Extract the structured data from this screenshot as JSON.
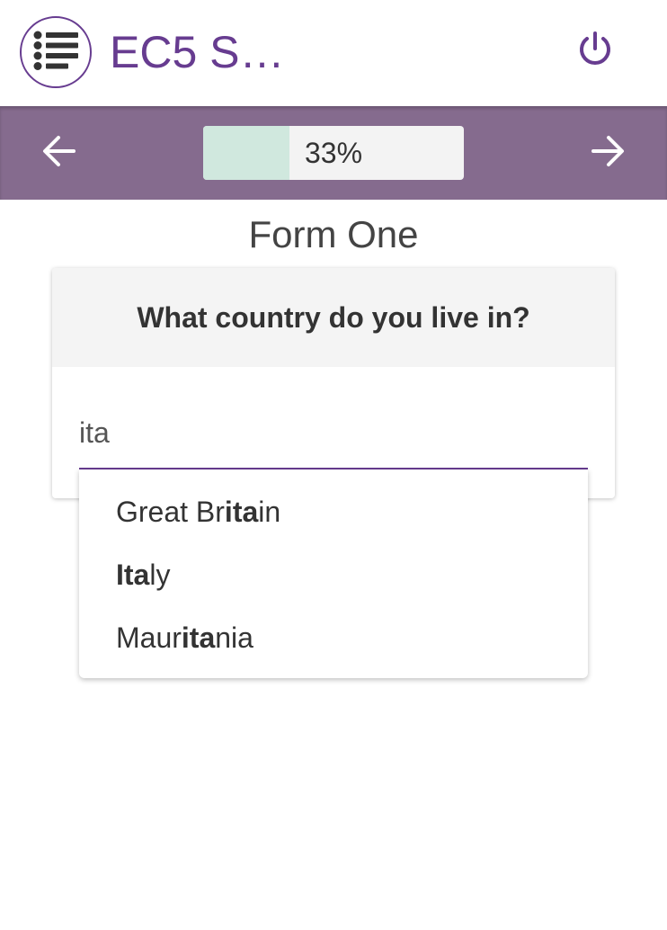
{
  "header": {
    "app_title": "EC5 S…",
    "menu_icon": "list-icon",
    "power_icon": "power-icon",
    "brand_color": "#673c90"
  },
  "nav": {
    "prev_icon": "arrow-left-icon",
    "next_icon": "arrow-right-icon",
    "progress_value": 0.33,
    "progress_label": "33%",
    "bar_color": "#856b8e"
  },
  "form": {
    "title": "Form One",
    "question": "What country do you live in?",
    "answer_value": "ita"
  },
  "suggestions": [
    {
      "before": "Great Br",
      "match": "ita",
      "after": "in"
    },
    {
      "before": "",
      "match": "Ita",
      "after": "ly"
    },
    {
      "before": "Maur",
      "match": "ita",
      "after": "nia"
    }
  ]
}
